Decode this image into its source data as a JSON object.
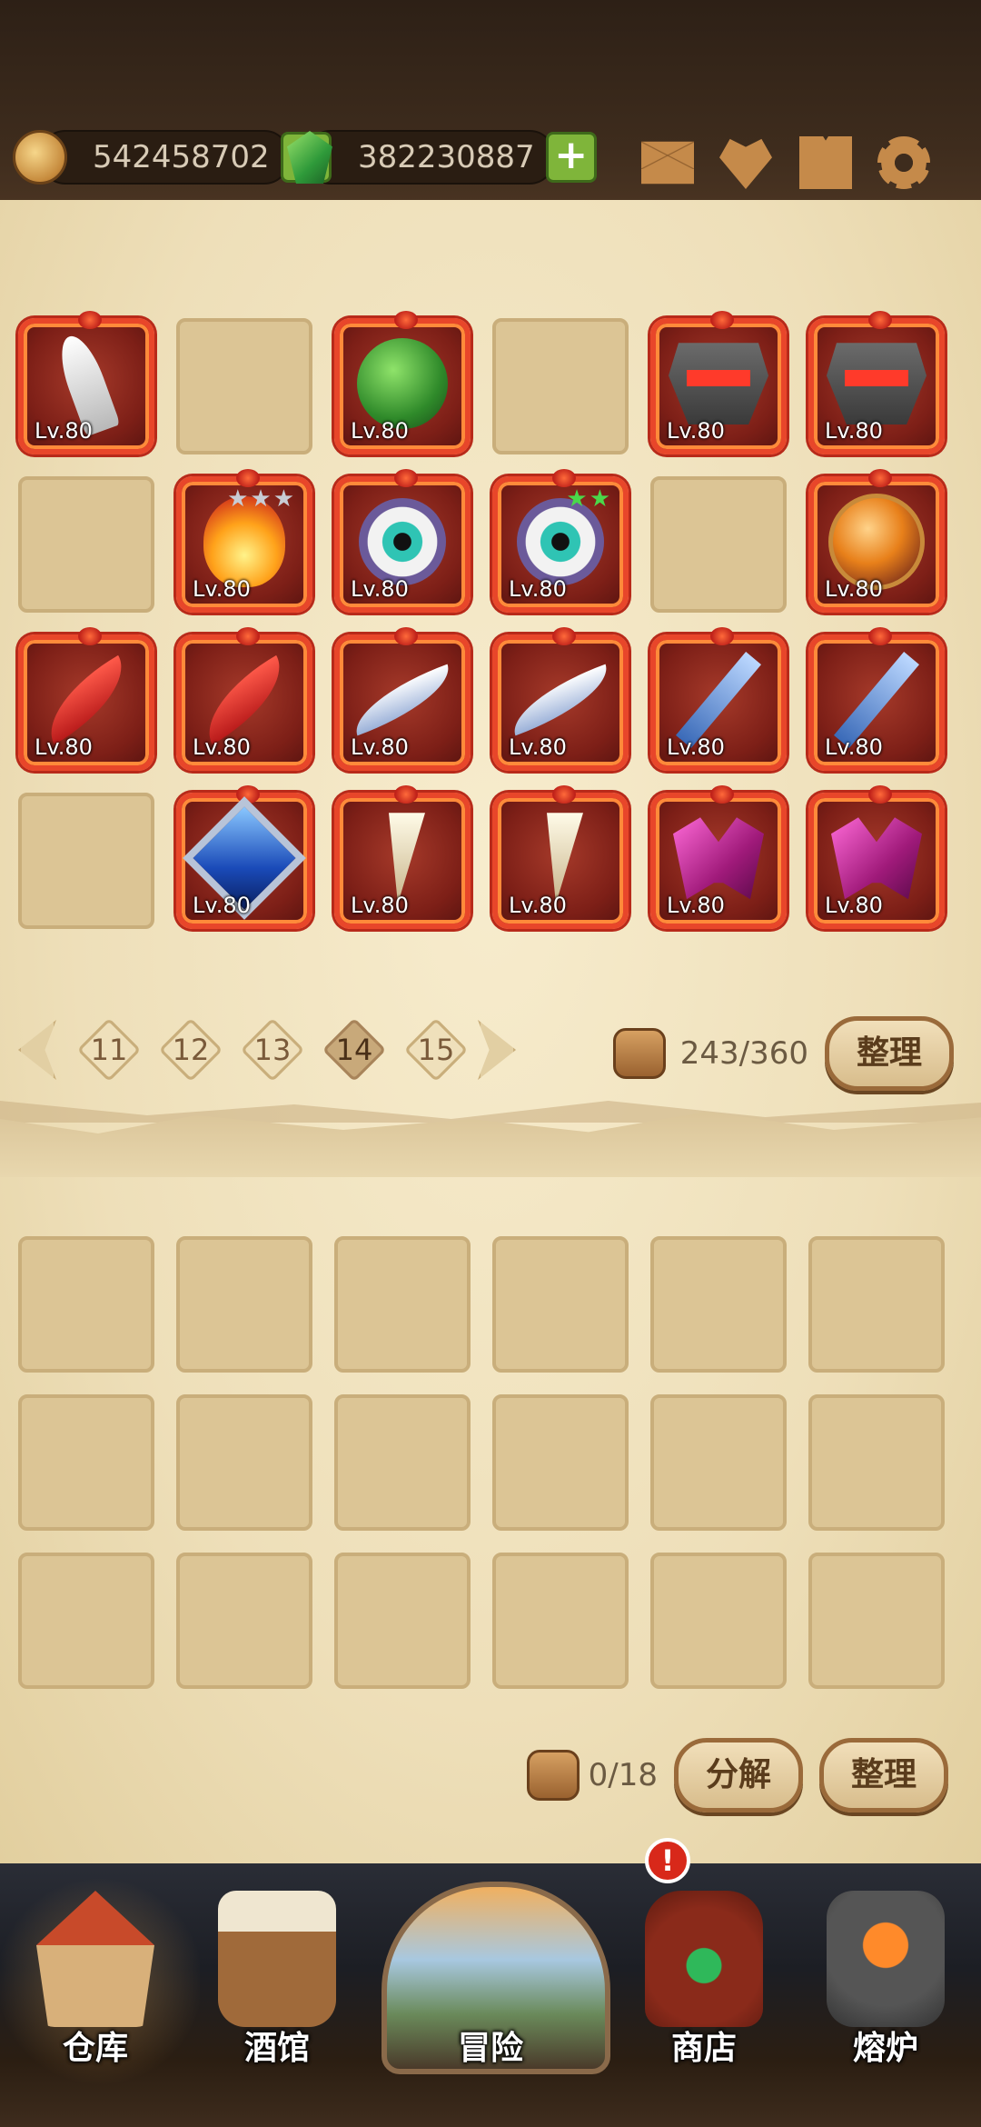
{
  "resources": {
    "gold": "542458702",
    "gems": "382230887"
  },
  "top_icons": [
    "mail-icon",
    "favorite-icon",
    "book-icon",
    "gear-icon"
  ],
  "storage": {
    "items": [
      {
        "lv": "Lv.80",
        "icon": "bone-blade-icon",
        "stars": ""
      },
      null,
      {
        "lv": "Lv.80",
        "icon": "beetle-shell-icon",
        "stars": ""
      },
      null,
      {
        "lv": "Lv.80",
        "icon": "demon-helm-icon",
        "stars": ""
      },
      {
        "lv": "Lv.80",
        "icon": "demon-helm-icon",
        "stars": ""
      },
      null,
      {
        "lv": "Lv.80",
        "icon": "fire-orb-icon",
        "stars": "★★★"
      },
      {
        "lv": "Lv.80",
        "icon": "eyeball-icon",
        "stars": ""
      },
      {
        "lv": "Lv.80",
        "icon": "eyeball-icon",
        "stars": "★★"
      },
      null,
      {
        "lv": "Lv.80",
        "icon": "amber-orb-icon",
        "stars": ""
      },
      {
        "lv": "Lv.80",
        "icon": "red-claw-icon",
        "stars": ""
      },
      {
        "lv": "Lv.80",
        "icon": "red-claw-icon",
        "stars": ""
      },
      {
        "lv": "Lv.80",
        "icon": "scimitar-icon",
        "stars": ""
      },
      {
        "lv": "Lv.80",
        "icon": "scimitar-icon",
        "stars": ""
      },
      {
        "lv": "Lv.80",
        "icon": "ice-spear-icon",
        "stars": ""
      },
      {
        "lv": "Lv.80",
        "icon": "ice-spear-icon",
        "stars": ""
      },
      null,
      {
        "lv": "Lv.80",
        "icon": "sapphire-amulet-icon",
        "stars": ""
      },
      {
        "lv": "Lv.80",
        "icon": "fang-necklace-icon",
        "stars": ""
      },
      {
        "lv": "Lv.80",
        "icon": "fang-necklace-icon",
        "stars": ""
      },
      {
        "lv": "Lv.80",
        "icon": "crystal-earring-icon",
        "stars": ""
      },
      {
        "lv": "Lv.80",
        "icon": "crystal-earring-icon",
        "stars": ""
      }
    ],
    "pages": [
      "11",
      "12",
      "13",
      "14",
      "15"
    ],
    "active_page": "14",
    "capacity": "243/360",
    "sort_label": "整理"
  },
  "crafting": {
    "slots": 18,
    "count": "0/18",
    "decompose_label": "分解",
    "sort_label": "整理"
  },
  "nav": {
    "warehouse": "仓库",
    "tavern": "酒馆",
    "adventure": "冒险",
    "shop": "商店",
    "forge": "熔炉",
    "shop_badge": "!"
  },
  "colors": {
    "item_frame": "#e8462a",
    "parchment": "#f3e6c3",
    "empty_slot": "#dcc595",
    "star_silver": "#c8ccd4",
    "star_green": "#4ad84a"
  }
}
